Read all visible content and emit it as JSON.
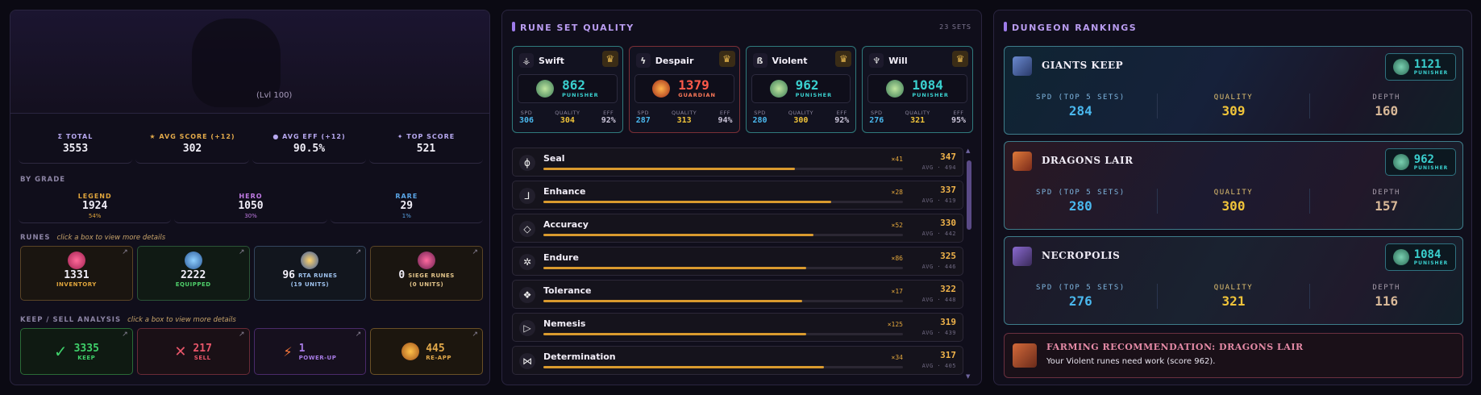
{
  "profile": {
    "level": "(Lvl 100)"
  },
  "summary": [
    {
      "icon": "sigma-icon",
      "label": "Σ TOTAL",
      "value": "3553",
      "color": "#b7a8f0"
    },
    {
      "icon": "star-icon",
      "label": "★ AVG SCORE (+12)",
      "value": "302",
      "color": "#e2a94a"
    },
    {
      "icon": "medal-icon",
      "label": "● AVG EFF (+12)",
      "value": "90.5%",
      "color": "#b7a8f0"
    },
    {
      "icon": "sparkle-icon",
      "label": "✦ TOP SCORE",
      "value": "521",
      "color": "#b7a8f0"
    }
  ],
  "by_grade": {
    "title": "BY GRADE",
    "grades": [
      {
        "label": "LEGEND",
        "value": "1924",
        "pct": "54%",
        "color": "#e0a53c"
      },
      {
        "label": "HERO",
        "value": "1050",
        "pct": "30%",
        "color": "#c27ce6"
      },
      {
        "label": "RARE",
        "value": "29",
        "pct": "1%",
        "color": "#5aa6e8"
      }
    ]
  },
  "runes": {
    "title": "RUNES",
    "hint": "click a box to view more details",
    "boxes": [
      {
        "value": "1331",
        "sub": "INVENTORY",
        "color": "#e0a53c"
      },
      {
        "value": "2222",
        "sub": "EQUIPPED",
        "color": "#4fcf6a"
      },
      {
        "value": "96",
        "sub": "RTA RUNES",
        "sub2": "(19 UNITS)",
        "color": "#7fb1e8"
      },
      {
        "value": "0",
        "sub": "SIEGE RUNES",
        "sub2": "(0 UNITS)",
        "color": "#e2a94a"
      }
    ]
  },
  "keep_sell": {
    "title": "KEEP / SELL ANALYSIS",
    "hint": "click a box to view more details",
    "boxes": [
      {
        "symbol": "✓",
        "value": "3335",
        "sub": "KEEP",
        "color": "#3fd06a"
      },
      {
        "symbol": "✕",
        "value": "217",
        "sub": "SELL",
        "color": "#e8566a"
      },
      {
        "symbol": "⚡",
        "value": "1",
        "sub": "POWER-UP",
        "color": "#a87ce6"
      },
      {
        "symbol": "",
        "value": "445",
        "sub": "RE-APP",
        "color": "#e2a94a"
      }
    ]
  },
  "rune_quality": {
    "title": "RUNE SET QUALITY",
    "count": "23 SETS",
    "cards": [
      {
        "name": "Swift",
        "symbol": "⚶",
        "score": "862",
        "rank": "PUNISHER",
        "score_color": "#3ad0cf",
        "border": "#2f7a7c",
        "spd": "306",
        "quality": "304",
        "eff": "92%"
      },
      {
        "name": "Despair",
        "symbol": "ϟ",
        "score": "1379",
        "rank": "GUARDIAN",
        "score_color": "#ff5a4a",
        "border": "#7a2f36",
        "spd": "287",
        "quality": "313",
        "eff": "94%"
      },
      {
        "name": "Violent",
        "symbol": "ß",
        "score": "962",
        "rank": "PUNISHER",
        "score_color": "#3ad0cf",
        "border": "#2f7a7c",
        "spd": "280",
        "quality": "300",
        "eff": "92%"
      },
      {
        "name": "Will",
        "symbol": "♆",
        "score": "1084",
        "rank": "PUNISHER",
        "score_color": "#3ad0cf",
        "border": "#2f7a7c",
        "spd": "276",
        "quality": "321",
        "eff": "95%"
      }
    ],
    "labels": {
      "spd": "SPD",
      "quality": "QUALITY",
      "eff": "EFF"
    },
    "rows": [
      {
        "name": "Seal",
        "symbol": "ɸ",
        "count": "×41",
        "score": "347",
        "avg": "AVG · 494",
        "fill": 0.7
      },
      {
        "name": "Enhance",
        "symbol": "⅃",
        "count": "×28",
        "score": "337",
        "avg": "AVG · 419",
        "fill": 0.8
      },
      {
        "name": "Accuracy",
        "symbol": "◇",
        "count": "×52",
        "score": "330",
        "avg": "AVG · 442",
        "fill": 0.75
      },
      {
        "name": "Endure",
        "symbol": "✲",
        "count": "×86",
        "score": "325",
        "avg": "AVG · 446",
        "fill": 0.73
      },
      {
        "name": "Tolerance",
        "symbol": "❖",
        "count": "×17",
        "score": "322",
        "avg": "AVG · 448",
        "fill": 0.72
      },
      {
        "name": "Nemesis",
        "symbol": "▷",
        "count": "×125",
        "score": "319",
        "avg": "AVG · 439",
        "fill": 0.73
      },
      {
        "name": "Determination",
        "symbol": "⋈",
        "count": "×34",
        "score": "317",
        "avg": "AVG · 405",
        "fill": 0.78
      }
    ]
  },
  "dungeons": {
    "title": "DUNGEON RANKINGS",
    "col_labels": {
      "spd": "SPD (TOP 5 SETS)",
      "quality": "QUALITY",
      "depth": "DEPTH"
    },
    "items": [
      {
        "name": "GIANTS KEEP",
        "score": "1121",
        "rank": "PUNISHER",
        "spd": "284",
        "quality": "309",
        "depth": "160"
      },
      {
        "name": "DRAGONS LAIR",
        "score": "962",
        "rank": "PUNISHER",
        "spd": "280",
        "quality": "300",
        "depth": "157"
      },
      {
        "name": "NECROPOLIS",
        "score": "1084",
        "rank": "PUNISHER",
        "spd": "276",
        "quality": "321",
        "depth": "116"
      }
    ],
    "recommendation": {
      "title": "FARMING RECOMMENDATION: DRAGONS LAIR",
      "text": "Your Violent runes need work (score 962)."
    }
  }
}
